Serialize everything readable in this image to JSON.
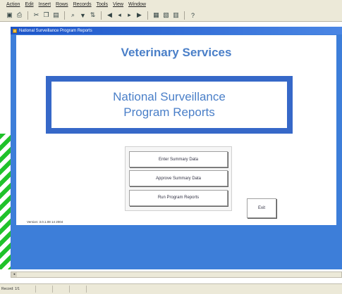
{
  "menu": [
    "Action",
    "Edit",
    "Insert",
    "Rows",
    "Records",
    "Tools",
    "View",
    "Window"
  ],
  "window_title": "National Surveillance Program Reports",
  "heading": "Veterinary Services",
  "title_box": {
    "line1": "National Surveillance",
    "line2": "Program Reports"
  },
  "buttons": {
    "enter": "Enter Summary Data",
    "approve": "Approve Summary Data",
    "run": "Run Program Reports",
    "exit": "Exit"
  },
  "version": "Version: 3.0.1.08 14 2004",
  "status": "Record: 1/1"
}
